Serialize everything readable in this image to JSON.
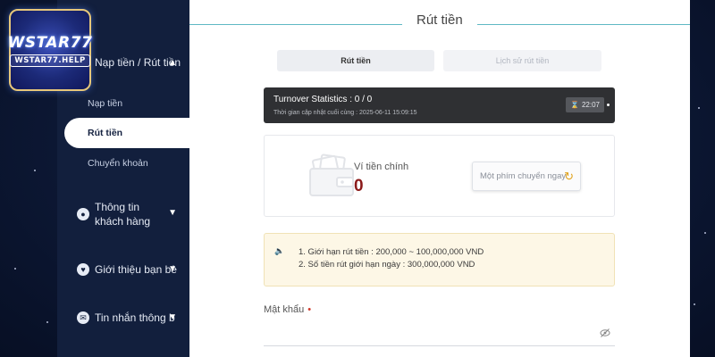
{
  "brand": {
    "logo_main": "WSTAR77",
    "logo_sub": "WSTAR77.HELP"
  },
  "sidebar": {
    "section_deposit": "Nạp tiền / Rút tiền",
    "sub_items": [
      "Nạp tiền",
      "Rút tiền",
      "Chuyển khoản"
    ],
    "active_sub": "Rút tiền",
    "customer_info": "Thông tin khách hàng",
    "referral": "Giới thiệu bạn bè",
    "messages": "Tin nhắn thông báo"
  },
  "page": {
    "title": "Rút tiền",
    "tabs": [
      {
        "label": "Rút tiền",
        "active": true
      },
      {
        "label": "Lịch sử rút tiền",
        "active": false
      }
    ]
  },
  "turnover": {
    "title": "Turnover Statistics : 0 / 0",
    "updated": "Thời gian cập nhật cuối cùng : 2025-06-11 15:09:15",
    "timer": "22:07"
  },
  "wallet": {
    "label": "Ví tiền chính",
    "balance": "0",
    "quick_transfer": "Một phím chuyển ngay"
  },
  "notice": {
    "lines": [
      "1. Giới hạn rút tiền : 200,000 ~ 100,000,000 VND",
      "2. Số tiền rút giới hạn ngày : 300,000,000 VND"
    ]
  },
  "password": {
    "label": "Mật khẩu",
    "required_mark": "•"
  },
  "colors": {
    "accent_line": "#5fb8c4",
    "balance": "#8b1a1a",
    "refresh_icon": "#e0a21b",
    "logo_border": "#e7c77a"
  }
}
